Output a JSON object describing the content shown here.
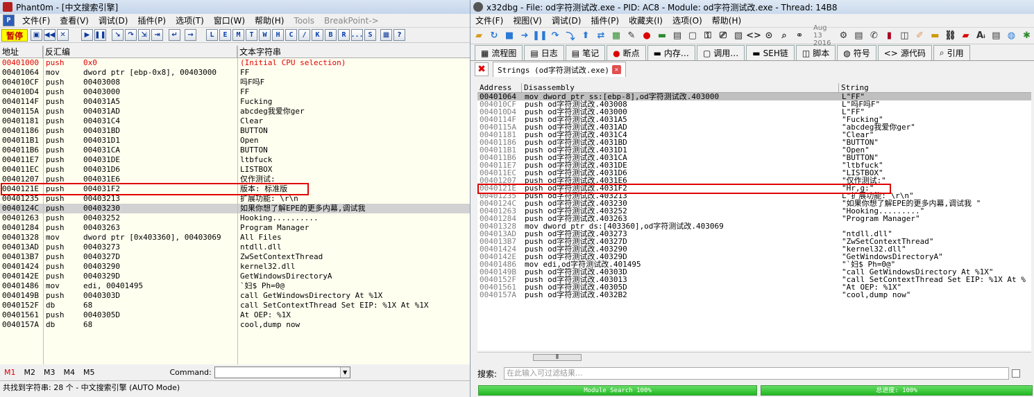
{
  "left": {
    "title": "Phant0m - [中文搜索引擎]",
    "menu": [
      "文件(F)",
      "查看(V)",
      "调试(D)",
      "插件(P)",
      "选项(T)",
      "窗口(W)",
      "帮助(H)",
      "Tools",
      "BreakPoint->"
    ],
    "pause_label": "暂停",
    "toolbar_letters": [
      "L",
      "E",
      "M",
      "T",
      "W",
      "H",
      "C",
      "/",
      "K",
      "B",
      "R",
      "...",
      "S"
    ],
    "columns": [
      "地址",
      "反汇编",
      "文本字符串"
    ],
    "rows": [
      {
        "addr": "00401000",
        "op": "push",
        "arg": "0x0",
        "str": "(Initial CPU selection)"
      },
      {
        "addr": "00401064",
        "op": "mov",
        "arg": "dword ptr [ebp-0x8], 00403000",
        "str": "FF"
      },
      {
        "addr": "004010CF",
        "op": "push",
        "arg": "00403008",
        "str": "吗F吗F"
      },
      {
        "addr": "004010D4",
        "op": "push",
        "arg": "00403000",
        "str": "FF"
      },
      {
        "addr": "0040114F",
        "op": "push",
        "arg": "004031A5",
        "str": "Fucking"
      },
      {
        "addr": "0040115A",
        "op": "push",
        "arg": "004031AD",
        "str": "abcdeg我爱你ger"
      },
      {
        "addr": "00401181",
        "op": "push",
        "arg": "004031C4",
        "str": "Clear"
      },
      {
        "addr": "00401186",
        "op": "push",
        "arg": "004031BD",
        "str": "BUTTON"
      },
      {
        "addr": "004011B1",
        "op": "push",
        "arg": "004031D1",
        "str": "Open"
      },
      {
        "addr": "004011B6",
        "op": "push",
        "arg": "004031CA",
        "str": "BUTTON"
      },
      {
        "addr": "004011E7",
        "op": "push",
        "arg": "004031DE",
        "str": "ltbfuck"
      },
      {
        "addr": "004011EC",
        "op": "push",
        "arg": "004031D6",
        "str": "LISTBOX"
      },
      {
        "addr": "00401207",
        "op": "push",
        "arg": "004031E6",
        "str": "仅作测试:"
      },
      {
        "addr": "0040121E",
        "op": "push",
        "arg": "004031F2",
        "str": "版本: 标准版"
      },
      {
        "addr": "00401235",
        "op": "push",
        "arg": "00403213",
        "str": "扩展功能: \\r\\n"
      },
      {
        "addr": "0040124C",
        "op": "push",
        "arg": "00403230",
        "str": "如果你想了解EPE的更多内幕,调试我"
      },
      {
        "addr": "00401263",
        "op": "push",
        "arg": "00403252",
        "str": "Hooking.........."
      },
      {
        "addr": "00401284",
        "op": "push",
        "arg": "00403263",
        "str": "Program Manager"
      },
      {
        "addr": "00401328",
        "op": "mov",
        "arg": "dword ptr [0x403360], 00403069",
        "str": "All Files"
      },
      {
        "addr": "004013AD",
        "op": "push",
        "arg": "00403273",
        "str": "ntdll.dll"
      },
      {
        "addr": "004013B7",
        "op": "push",
        "arg": "0040327D",
        "str": "ZwSetContextThread"
      },
      {
        "addr": "00401424",
        "op": "push",
        "arg": "00403290",
        "str": "kernel32.dll"
      },
      {
        "addr": "0040142E",
        "op": "push",
        "arg": "0040329D",
        "str": "GetWindowsDirectoryA"
      },
      {
        "addr": "00401486",
        "op": "mov",
        "arg": "edi, 00401495",
        "str": "`妇$ Ph=0@"
      },
      {
        "addr": "0040149B",
        "op": "push",
        "arg": "0040303D",
        "str": "call GetWindowsDirectory At %1X"
      },
      {
        "addr": "0040152F",
        "op": "db",
        "arg": "68",
        "str": "call SetContextThread Set EIP: %1X At %1X"
      },
      {
        "addr": "00401561",
        "op": "push",
        "arg": "0040305D",
        "str": "At OEP: %1X"
      },
      {
        "addr": "0040157A",
        "op": "db",
        "arg": "68",
        "str": "cool,dump now"
      }
    ],
    "marks": [
      "M1",
      "M2",
      "M3",
      "M4",
      "M5"
    ],
    "command_label": "Command:",
    "status": "共找到字符串: 28 个 - 中文搜索引擎 (AUTO Mode)"
  },
  "right": {
    "title": "x32dbg - File: od字符测试改.exe - PID: AC8 - Module: od字符测试改.exe - Thread: 14B8",
    "menu": [
      "文件(F)",
      "视图(V)",
      "调试(D)",
      "插件(P)",
      "收藏夹(I)",
      "选项(O)",
      "帮助(H)"
    ],
    "date": "Aug 13 2016",
    "tabs": [
      "流程图",
      "日志",
      "笔记",
      "断点",
      "内存…",
      "调用…",
      "SEH链",
      "脚本",
      "符号",
      "源代码",
      "引用"
    ],
    "subtab": "Strings (od字符测试改.exe)",
    "columns": [
      "Address",
      "Disassembly",
      "String"
    ],
    "rows": [
      {
        "addr": "00401064",
        "dis": "mov dword ptr ss:[ebp-8],od字符测试改.403000",
        "str": "L\"FF\""
      },
      {
        "addr": "004010CF",
        "dis": "push od字符测试改.403008",
        "str": "L\"吗F吗F\""
      },
      {
        "addr": "004010D4",
        "dis": "push od字符测试改.403000",
        "str": "L\"FF\""
      },
      {
        "addr": "0040114F",
        "dis": "push od字符测试改.4031A5",
        "str": "\"Fucking\""
      },
      {
        "addr": "0040115A",
        "dis": "push od字符测试改.4031AD",
        "str": "\"abcdeg我爱你ger\""
      },
      {
        "addr": "00401181",
        "dis": "push od字符测试改.4031C4",
        "str": "\"Clear\""
      },
      {
        "addr": "00401186",
        "dis": "push od字符测试改.4031BD",
        "str": "\"BUTTON\""
      },
      {
        "addr": "004011B1",
        "dis": "push od字符测试改.4031D1",
        "str": "\"Open\""
      },
      {
        "addr": "004011B6",
        "dis": "push od字符测试改.4031CA",
        "str": "\"BUTTON\""
      },
      {
        "addr": "004011E7",
        "dis": "push od字符测试改.4031DE",
        "str": "\"ltbfuck\""
      },
      {
        "addr": "004011EC",
        "dis": "push od字符测试改.4031D6",
        "str": "\"LISTBOX\""
      },
      {
        "addr": "00401207",
        "dis": "push od字符测试改.4031E6",
        "str": "\"仅作测试:\""
      },
      {
        "addr": "0040121E",
        "dis": "push od字符测试改.4031F2",
        "str": "\"Hr,g:\""
      },
      {
        "addr": "00401235",
        "dis": "push od字符测试改.403213",
        "str": "L\"扩展功能: \\r\\n\""
      },
      {
        "addr": "0040124C",
        "dis": "push od字符测试改.403230",
        "str": "\"如果你想了解EPE的更多内幕,调试我 \""
      },
      {
        "addr": "00401263",
        "dis": "push od字符测试改.403252",
        "str": "\"Hooking.........\""
      },
      {
        "addr": "00401284",
        "dis": "push od字符测试改.403263",
        "str": "\"Program Manager\""
      },
      {
        "addr": "00401328",
        "dis": "mov dword ptr ds:[403360],od字符测试改.403069",
        "str": ""
      },
      {
        "addr": "004013AD",
        "dis": "push od字符测试改.403273",
        "str": "\"ntdll.dll\""
      },
      {
        "addr": "004013B7",
        "dis": "push od字符测试改.40327D",
        "str": "\"ZwSetContextThread\""
      },
      {
        "addr": "00401424",
        "dis": "push od字符测试改.403290",
        "str": "\"kernel32.dll\""
      },
      {
        "addr": "0040142E",
        "dis": "push od字符测试改.40329D",
        "str": "\"GetWindowsDirectoryA\""
      },
      {
        "addr": "00401486",
        "dis": "mov edi,od字符测试改.401495",
        "str": "\"`妇$ Ph=0@\""
      },
      {
        "addr": "0040149B",
        "dis": "push od字符测试改.40303D",
        "str": "\"call GetWindowsDirectory At %1X\""
      },
      {
        "addr": "0040152F",
        "dis": "push od字符测试改.403013",
        "str": "\"call SetContextThread Set EIP: %1X At %"
      },
      {
        "addr": "00401561",
        "dis": "push od字符测试改.40305D",
        "str": "\"At OEP: %1X\""
      },
      {
        "addr": "0040157A",
        "dis": "push od字符测试改.4032B2",
        "str": "\"cool,dump now\""
      }
    ],
    "search_label": "搜索:",
    "search_placeholder": "在此输入可过滤结果...",
    "progress_module": "Module Search 100%",
    "progress_total": "总进度: 100%"
  }
}
